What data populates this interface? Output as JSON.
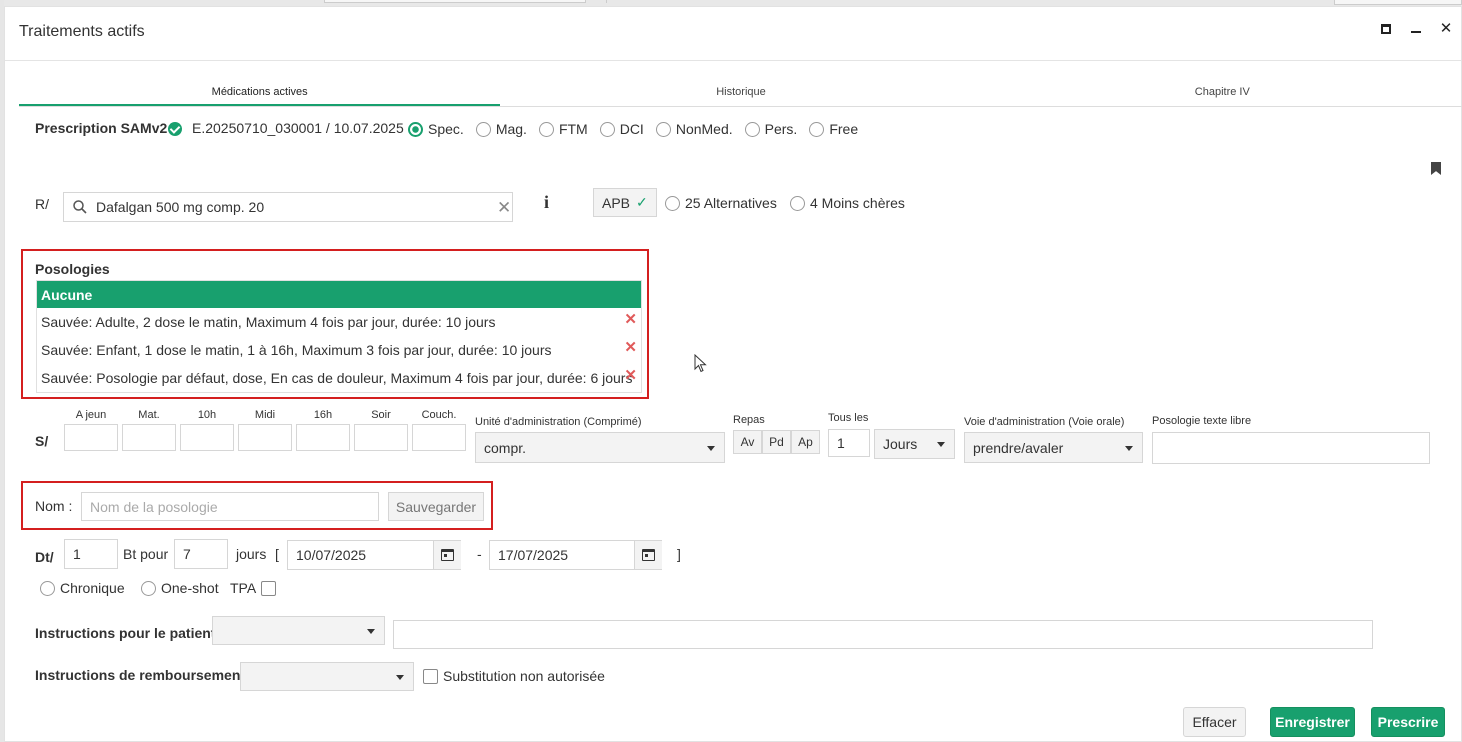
{
  "window": {
    "title": "Traitements actifs"
  },
  "tabs": [
    "Médications actives",
    "Historique",
    "Chapitre IV"
  ],
  "prescription": {
    "label": "Prescription SAMv2",
    "ref": "E.20250710_030001 / 10.07.2025",
    "types": [
      "Spec.",
      "Mag.",
      "FTM",
      "DCI",
      "NonMed.",
      "Pers.",
      "Free"
    ],
    "selected_type": "Spec."
  },
  "rx": {
    "label": "R/",
    "search_value": "Dafalgan 500 mg comp. 20",
    "apb_label": "APB",
    "alternatives": "25 Alternatives",
    "cheaper": "4 Moins chères"
  },
  "posologies": {
    "title": "Posologies",
    "selected": "Aucune",
    "items": [
      "Sauvée: Adulte, 2 dose le matin, Maximum 4 fois par jour, durée: 10 jours",
      "Sauvée: Enfant, 1 dose le matin, 1 à 16h, Maximum 3 fois par jour, durée: 10 jours",
      "Sauvée: Posologie par défaut, dose, En cas de douleur, Maximum 4 fois par jour, durée: 6 jours"
    ]
  },
  "schedule": {
    "label": "S/",
    "slots": [
      "A jeun",
      "Mat.",
      "10h",
      "Midi",
      "16h",
      "Soir",
      "Couch."
    ],
    "unit_label": "Unité d'administration  (Comprimé)",
    "unit_value": "compr.",
    "repas_label": "Repas",
    "repas": [
      "Av",
      "Pd",
      "Ap"
    ],
    "tous_les_label": "Tous les",
    "tous_les_value": "1",
    "period_value": "Jours",
    "voie_label": "Voie d'administration (Voie orale)",
    "voie_value": "prendre/avaler",
    "libre_label": "Posologie texte libre"
  },
  "nom": {
    "label": "Nom :",
    "placeholder": "Nom de la posologie",
    "save": "Sauvegarder"
  },
  "duration": {
    "label": "Dt/",
    "qty": "1",
    "bt_pour": "Bt pour",
    "days": "7",
    "jours": "jours",
    "bracket_open": "[",
    "dash": "-",
    "bracket_close": "]",
    "start": "10/07/2025",
    "end": "17/07/2025",
    "chronique": "Chronique",
    "oneshot": "One-shot",
    "tpa": "TPA"
  },
  "instructions": {
    "patient_label": "Instructions pour le patient",
    "rembours_label": "Instructions de remboursement",
    "substitution": "Substitution non autorisée"
  },
  "footer": {
    "effacer": "Effacer",
    "enregistrer": "Enregistrer",
    "prescrire": "Prescrire"
  },
  "colors": {
    "accent": "#18a06e",
    "highlight": "#d41f1f",
    "delete": "#e05a5a"
  }
}
